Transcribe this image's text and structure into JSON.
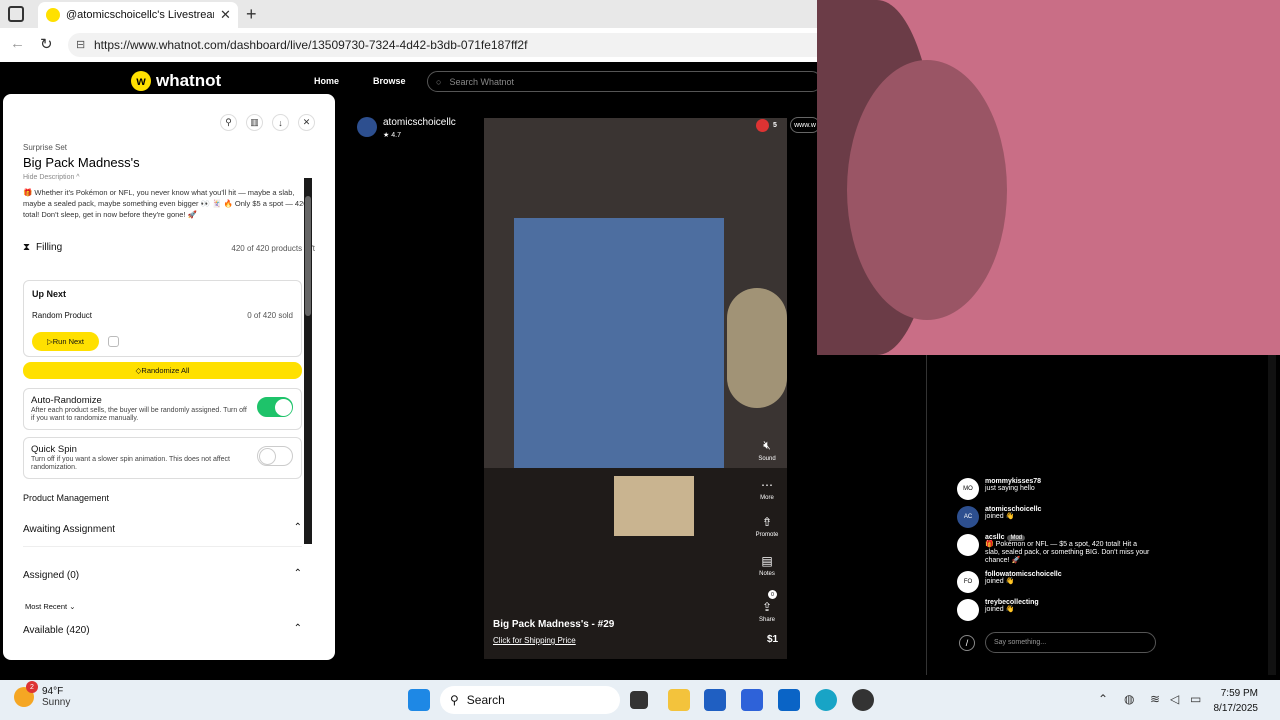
{
  "browser": {
    "tab_title": "@atomicschoicellc's Livestream o",
    "url": "https://www.whatnot.com/dashboard/live/13509730-7324-4d42-b3db-071fe187ff2f"
  },
  "header": {
    "logo": "whatnot",
    "nav": [
      "Home",
      "Browse"
    ],
    "search_placeholder": "Search Whatnot"
  },
  "panel": {
    "label": "Surprise Set",
    "title": "Big Pack Madness's",
    "hide_description": "Hide Description ^",
    "description": "🎁 Whether it's Pokémon or NFL, you never know what you'll hit — maybe a slab, maybe a sealed pack, maybe something even bigger 👀 🃏 🔥 Only $5 a spot — 420 total! Don't sleep, get in now before they're gone! 🚀",
    "filling_label": "Filling",
    "products_left": "420 of 420 products left",
    "up_next": {
      "heading": "Up Next",
      "product": "Random Product",
      "sold": "0 of 420 sold",
      "run_next": "Run Next"
    },
    "randomize_all": "Randomize All",
    "auto_randomize": {
      "title": "Auto-Randomize",
      "desc": "After each product sells, the buyer will be randomly assigned. Turn off if you want to randomize manually.",
      "on": true
    },
    "quick_spin": {
      "title": "Quick Spin",
      "desc": "Turn off if you want a slower spin animation. This does not affect randomization.",
      "on": false
    },
    "product_management": "Product Management",
    "awaiting": "Awaiting Assignment",
    "assigned": "Assigned (0)",
    "sort": "Most Recent",
    "available": "Available (420)"
  },
  "stream": {
    "seller": "atomicschoicellc",
    "rating": "4.7",
    "viewers": "5",
    "www_label": "www.w",
    "title": "Big Pack Madness's - #29",
    "shipping": "Click for Shipping Price",
    "price": "$1",
    "controls": [
      "Sound",
      "More",
      "Promote",
      "Notes",
      "Share"
    ],
    "share_count": "0"
  },
  "chat": {
    "messages": [
      {
        "avatar": "MO",
        "name": "mommykisses78",
        "text": "just saying hello",
        "mod": ""
      },
      {
        "avatar": "AC",
        "name": "atomicschoicellc",
        "text": "joined 👋",
        "mod": ""
      },
      {
        "avatar": "",
        "name": "acsllc",
        "text": "🎁 Pokémon or NFL — $5 a spot, 420 total! Hit a slab, sealed pack, or something BIG. Don't miss your chance! 🚀",
        "mod": "Mod"
      },
      {
        "avatar": "FO",
        "name": "followatomicschoicellc",
        "text": "joined 👋",
        "mod": ""
      },
      {
        "avatar": "",
        "name": "treybecollecting",
        "text": "joined 👋",
        "mod": ""
      }
    ],
    "placeholder": "Say something..."
  },
  "taskbar": {
    "weather_badge": "2",
    "temp": "94°F",
    "condition": "Sunny",
    "search": "Search",
    "time": "7:59 PM",
    "date": "8/17/2025"
  },
  "colors": {
    "accent": "#ffe000",
    "toggle_on": "#1ec36a",
    "live": "#dd3333"
  }
}
